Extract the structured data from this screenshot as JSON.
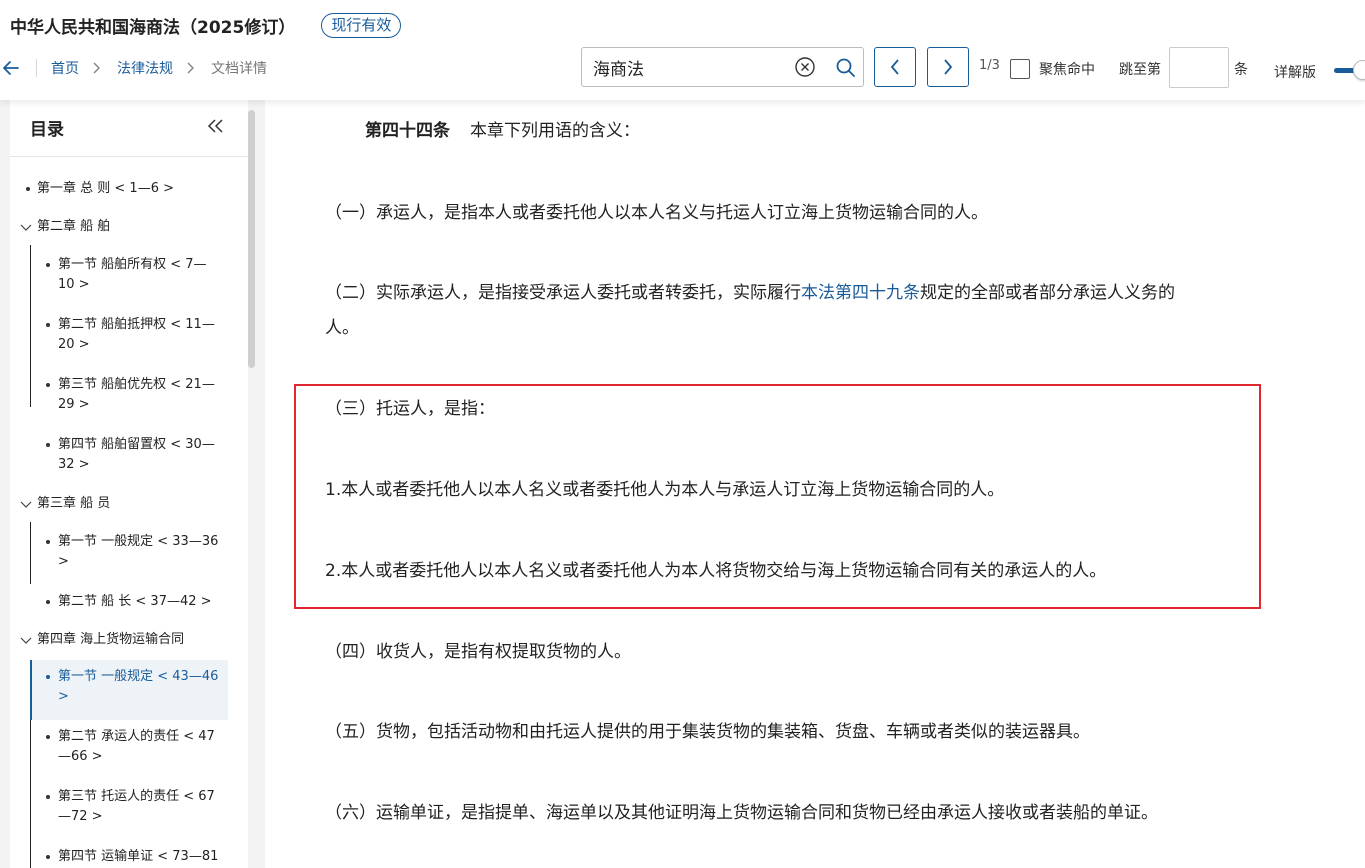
{
  "header": {
    "title": "中华人民共和国海商法（2025修订）",
    "status": "现行有效"
  },
  "breadcrumb": [
    "首页",
    "法律法规",
    "文档详情"
  ],
  "search": {
    "value": "海商法",
    "hit_count": "1/3",
    "focus_label": "聚焦命中",
    "jump_label": "跳至第",
    "jump_unit": "条",
    "detail_label": "详解版"
  },
  "toc": {
    "title": "目录",
    "items": [
      {
        "text": "第一章 总 则 < 1—6 >"
      },
      {
        "text": "第二章 船 舶"
      },
      {
        "line1": "第一节 船舶所有权 < 7—",
        "line2": "10 >"
      },
      {
        "line1": "第二节 船舶抵押权 < 11—",
        "line2": "20 >"
      },
      {
        "line1": "第三节 船舶优先权 < 21—",
        "line2": "29 >"
      },
      {
        "line1": "第四节 船舶留置权 < 30—",
        "line2": "32 >"
      },
      {
        "text": "第三章 船 员"
      },
      {
        "line1": "第一节 一般规定 < 33—36",
        "line2": ">"
      },
      {
        "text": "第二节 船 长 < 37—42 >"
      },
      {
        "text": "第四章 海上货物运输合同"
      },
      {
        "line1": "第一节 一般规定 < 43—46",
        "line2": ">"
      },
      {
        "line1": "第二节 承运人的责任 < 47",
        "line2": "—66 >"
      },
      {
        "line1": "第三节 托运人的责任 < 67",
        "line2": "—72 >"
      },
      {
        "text": "第四节 运输单证 < 73—81"
      }
    ]
  },
  "article": {
    "label": "第四十四条",
    "intro": "本章下列用语的含义：",
    "p1": "（一）承运人，是指本人或者委托他人以本人名义与托运人订立海上货物运输合同的人。",
    "p2_before": "（二）实际承运人，是指接受承运人委托或者转委托，实际履行",
    "p2_link": "本法第四十九条",
    "p2_after": "规定的全部或者部分承运人义务的",
    "p2_line2": "人。",
    "p3": "（三）托运人，是指：",
    "p3_1": "1.本人或者委托他人以本人名义或者委托他人为本人与承运人订立海上货物运输合同的人。",
    "p3_2": "2.本人或者委托他人以本人名义或者委托他人为本人将货物交给与海上货物运输合同有关的承运人的人。",
    "p4": "（四）收货人，是指有权提取货物的人。",
    "p5": "（五）货物，包括活动物和由托运人提供的用于集装货物的集装箱、货盘、车辆或者类似的装运器具。",
    "p6": "（六）运输单证，是指提单、海运单以及其他证明海上货物运输合同和货物已经由承运人接收或者装船的单证。"
  },
  "colors": {
    "accent": "#1a5c9a",
    "highlight_border": "#e0262f"
  }
}
